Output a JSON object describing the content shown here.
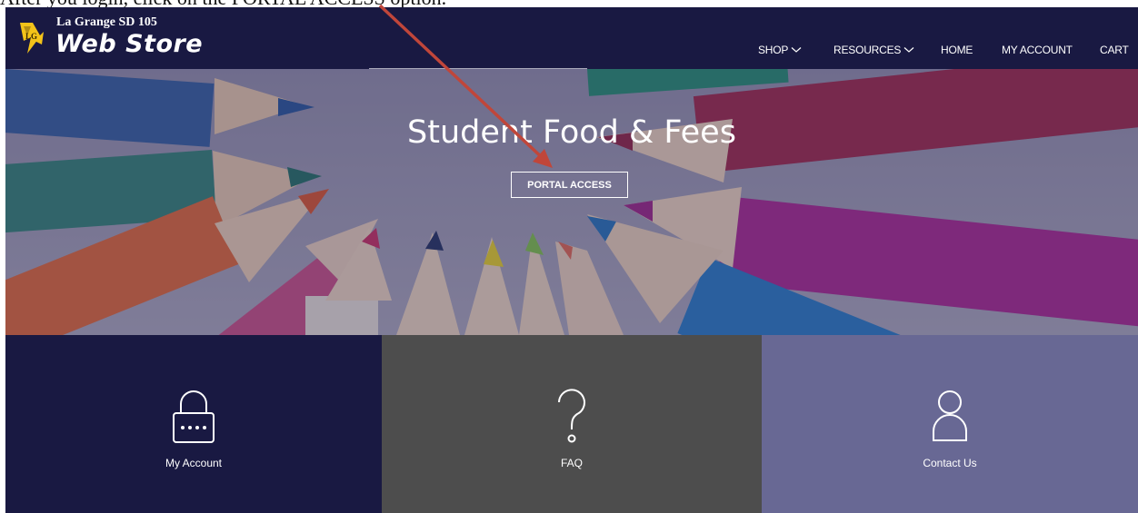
{
  "caption": {
    "text": "After you login, click on the PORTAL ACCESS option."
  },
  "header": {
    "brand_small": "La Grange SD 105",
    "brand_big": "Web Store",
    "nav": [
      {
        "label": "SHOP",
        "dropdown": true
      },
      {
        "label": "RESOURCES",
        "dropdown": true
      },
      {
        "label": "HOME",
        "dropdown": false
      },
      {
        "label": "MY ACCOUNT",
        "dropdown": false
      },
      {
        "label": "CART",
        "dropdown": false
      }
    ]
  },
  "hero": {
    "title": "Student Food & Fees",
    "button_label": "PORTAL ACCESS"
  },
  "tiles": [
    {
      "label": "My Account",
      "icon": "lock-icon",
      "color": "#191942"
    },
    {
      "label": "FAQ",
      "icon": "question-icon",
      "color": "#4d4d4d"
    },
    {
      "label": "Contact Us",
      "icon": "user-icon",
      "color": "#686894"
    }
  ],
  "colors": {
    "navbar": "#191942",
    "annotation_arrow": "#c0463a"
  }
}
